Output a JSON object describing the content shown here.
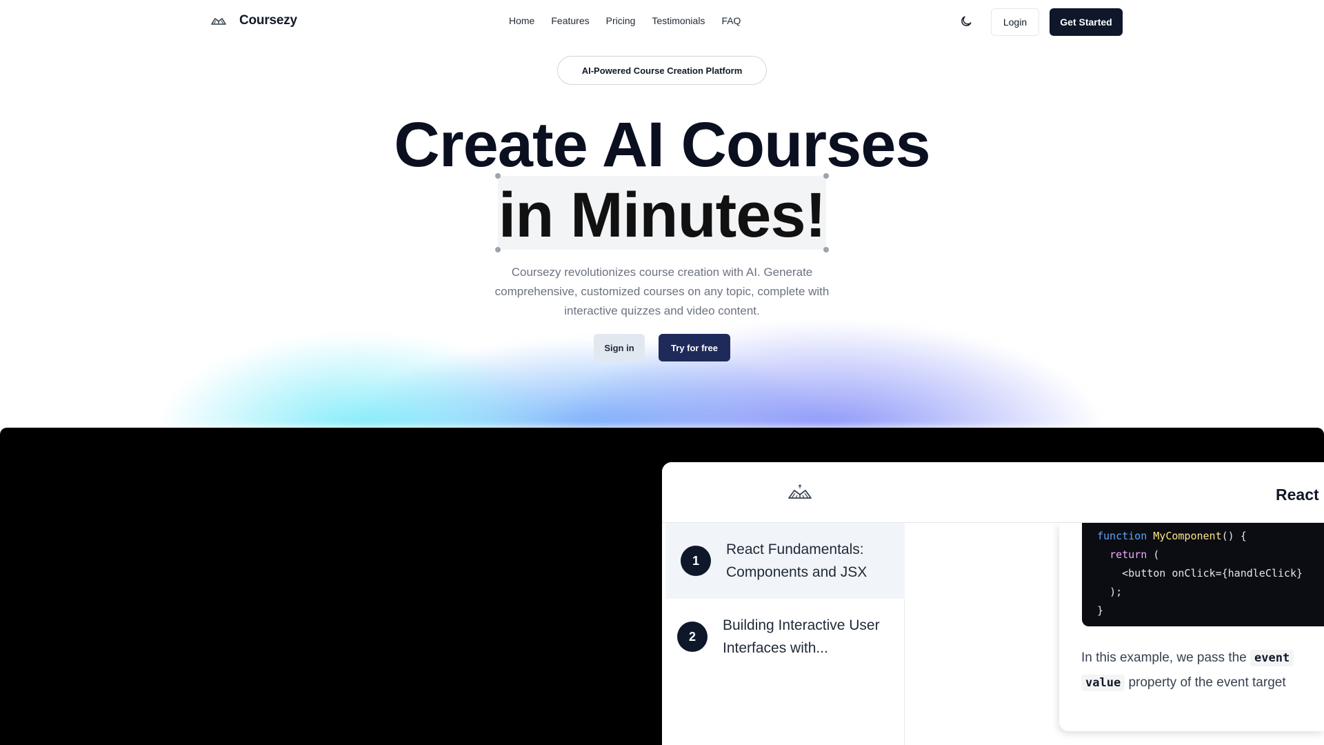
{
  "nav": {
    "brand": "Coursezy",
    "links": [
      "Home",
      "Features",
      "Pricing",
      "Testimonials",
      "FAQ"
    ],
    "login_label": "Login",
    "get_started_label": "Get Started"
  },
  "hero": {
    "badge": "AI-Powered Course Creation Platform",
    "headline_line1": "Create AI Courses",
    "headline_line2": "in Minutes!",
    "subtext": "Coursezy revolutionizes course creation with AI. Generate comprehensive, customized courses on any topic, complete with interactive quizzes and video content.",
    "signin_label": "Sign in",
    "tryfree_label": "Try for free"
  },
  "demo": {
    "app_title": "React",
    "lessons": [
      {
        "number": "1",
        "title": "React Fundamentals: Components and JSX"
      },
      {
        "number": "2",
        "title": "Building Interactive User Interfaces with..."
      }
    ],
    "code": {
      "line1_kw": "function",
      "line1_fn": "MyComponent",
      "line1_rest": "() {",
      "line2_kw": "return",
      "line2_rest": " (",
      "line3": "<button onClick={handleClick}",
      "line4": ");",
      "line5": "}"
    },
    "prose_line1_text": "In this example, we pass the ",
    "prose_line1_code": "event",
    "prose_line2_code": "value",
    "prose_line2_text": " property of the event target"
  },
  "colors": {
    "primary_dark": "#0f172a",
    "try_free_bg": "#1e2a5a",
    "glow_cyan": "#67e8f9",
    "glow_indigo": "#818cf8"
  }
}
